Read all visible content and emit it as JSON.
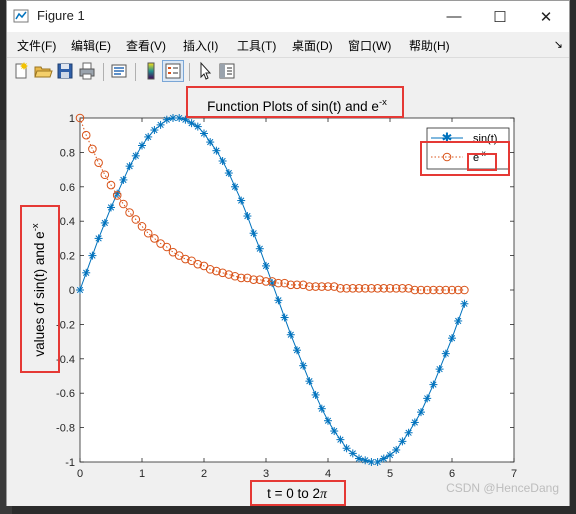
{
  "window": {
    "title": "Figure 1",
    "controls": {
      "minimize": "—",
      "maximize": "☐",
      "close": "✕"
    }
  },
  "menu": {
    "items": [
      {
        "label": "文件(F)"
      },
      {
        "label": "编辑(E)"
      },
      {
        "label": "查看(V)"
      },
      {
        "label": "插入(I)"
      },
      {
        "label": "工具(T)"
      },
      {
        "label": "桌面(D)"
      },
      {
        "label": "窗口(W)"
      },
      {
        "label": "帮助(H)"
      }
    ],
    "overflow": "↘"
  },
  "toolbar": {
    "buttons": [
      "new-figure-icon",
      "open-folder-icon",
      "save-icon",
      "print-icon",
      "link-plot-icon",
      "colorbar-icon",
      "legend-icon",
      "pointer-icon",
      "property-editor-icon"
    ]
  },
  "plot": {
    "title_main": "Function Plots of sin(t) and e",
    "title_sup": "-x",
    "xlabel_main": "t = 0 to 2",
    "xlabel_pi": "π",
    "ylabel_main": "values of sin(t) and e",
    "ylabel_sup": "-x",
    "legend": [
      {
        "label": "sin(t)",
        "marker": "*",
        "color": "#0072BD"
      },
      {
        "label_main": "e",
        "label_sup": "-x",
        "marker": "o",
        "color": "#D95319"
      }
    ]
  },
  "chart_data": {
    "type": "line",
    "title": "Function Plots of sin(t) and e^-x",
    "xlabel": "t = 0 to 2π",
    "ylabel": "values of sin(t) and e^-x",
    "xlim": [
      0,
      7
    ],
    "ylim": [
      -1,
      1
    ],
    "xticks": [
      0,
      1,
      2,
      3,
      4,
      5,
      6,
      7
    ],
    "yticks": [
      -1,
      -0.8,
      -0.6,
      -0.4,
      -0.2,
      0,
      0.2,
      0.4,
      0.6,
      0.8,
      1
    ],
    "grid": false,
    "legend_position": "top-right",
    "x": [
      0,
      0.1,
      0.2,
      0.3,
      0.4,
      0.5,
      0.6,
      0.7,
      0.8,
      0.9,
      1.0,
      1.1,
      1.2,
      1.3,
      1.4,
      1.5,
      1.6,
      1.7,
      1.8,
      1.9,
      2.0,
      2.1,
      2.2,
      2.3,
      2.4,
      2.5,
      2.6,
      2.7,
      2.8,
      2.9,
      3.0,
      3.1,
      3.2,
      3.3,
      3.4,
      3.5,
      3.6,
      3.7,
      3.8,
      3.9,
      4.0,
      4.1,
      4.2,
      4.3,
      4.4,
      4.5,
      4.6,
      4.7,
      4.8,
      4.9,
      5.0,
      5.1,
      5.2,
      5.3,
      5.4,
      5.5,
      5.6,
      5.7,
      5.8,
      5.9,
      6.0,
      6.1,
      6.2
    ],
    "series": [
      {
        "name": "sin(t)",
        "color": "#0072BD",
        "marker": "*",
        "line": "solid",
        "values": [
          0,
          0.1,
          0.2,
          0.3,
          0.39,
          0.48,
          0.56,
          0.64,
          0.72,
          0.78,
          0.84,
          0.89,
          0.93,
          0.96,
          0.99,
          1.0,
          1.0,
          0.99,
          0.97,
          0.95,
          0.91,
          0.86,
          0.81,
          0.75,
          0.68,
          0.6,
          0.52,
          0.43,
          0.33,
          0.24,
          0.14,
          0.04,
          -0.06,
          -0.16,
          -0.26,
          -0.35,
          -0.44,
          -0.53,
          -0.61,
          -0.69,
          -0.76,
          -0.82,
          -0.87,
          -0.92,
          -0.95,
          -0.98,
          -0.99,
          -1.0,
          -1.0,
          -0.98,
          -0.96,
          -0.93,
          -0.88,
          -0.83,
          -0.77,
          -0.71,
          -0.63,
          -0.55,
          -0.46,
          -0.37,
          -0.28,
          -0.18,
          -0.08
        ]
      },
      {
        "name": "e^-x",
        "color": "#D95319",
        "marker": "o",
        "line": "dotted",
        "values": [
          1.0,
          0.9,
          0.82,
          0.74,
          0.67,
          0.61,
          0.55,
          0.5,
          0.45,
          0.41,
          0.37,
          0.33,
          0.3,
          0.27,
          0.25,
          0.22,
          0.2,
          0.18,
          0.17,
          0.15,
          0.14,
          0.12,
          0.11,
          0.1,
          0.09,
          0.08,
          0.07,
          0.07,
          0.06,
          0.06,
          0.05,
          0.05,
          0.04,
          0.04,
          0.03,
          0.03,
          0.03,
          0.02,
          0.02,
          0.02,
          0.02,
          0.02,
          0.01,
          0.01,
          0.01,
          0.01,
          0.01,
          0.01,
          0.01,
          0.01,
          0.01,
          0.01,
          0.01,
          0.01,
          0.0,
          0.0,
          0.0,
          0.0,
          0.0,
          0.0,
          0.0,
          0.0,
          0.0
        ]
      }
    ]
  },
  "watermark": "CSDN @HenceDang"
}
